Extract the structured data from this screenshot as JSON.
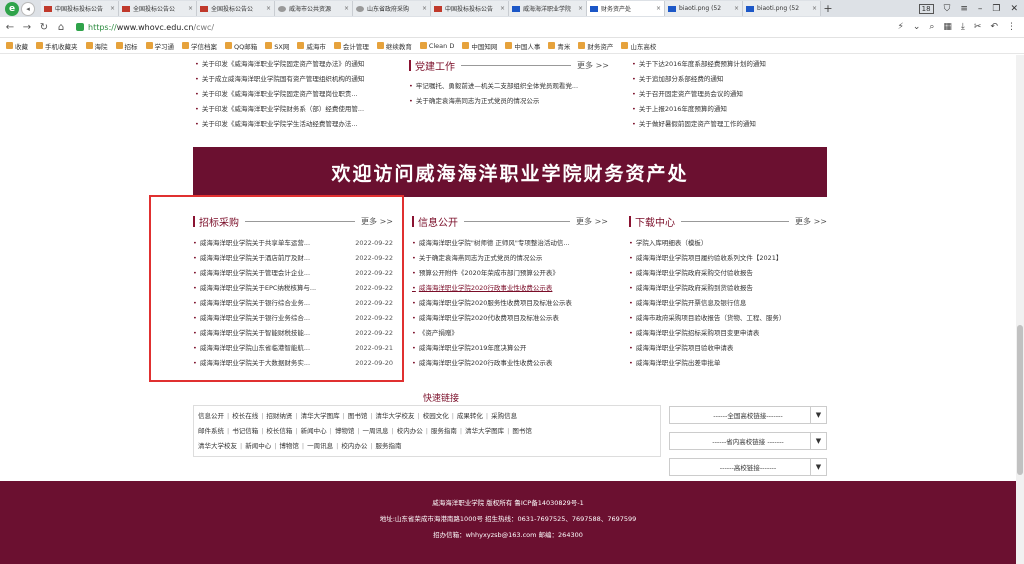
{
  "browser": {
    "tabs": [
      {
        "label": "中国投标投标公告",
        "active": false
      },
      {
        "label": "全国投标公告公",
        "active": false
      },
      {
        "label": "全国投标公告公",
        "active": false
      },
      {
        "label": "威海市公共资源",
        "active": false
      },
      {
        "label": "山东省政府采购",
        "active": false
      },
      {
        "label": "中国投标投标公告",
        "active": false
      },
      {
        "label": "威海海洋职业学院",
        "active": false
      },
      {
        "label": "财务资产处",
        "active": true
      },
      {
        "label": "biaoti.png (52",
        "active": false
      },
      {
        "label": "biaoti.png (52",
        "active": false
      }
    ],
    "window_counter": "18",
    "url_scheme": "https://",
    "url_host": "www.whovc.edu.cn",
    "url_path": "/cwc/",
    "bookmarks": [
      "收藏",
      "手机收藏夹",
      "海院",
      "招标",
      "学习通",
      "学信档案",
      "QQ邮箱",
      "SX网",
      "威海市",
      "会计管理",
      "继续教育",
      "Clean D",
      "中国知网",
      "中国人事",
      "青米",
      "财务资产",
      "山东高校"
    ]
  },
  "top_section": {
    "left_items": [
      "关于印发《威海海洋职业学院固定资产管理办法》的通知",
      "关于成立威海海洋职业学院国有资产管理组织机构的通知",
      "关于印发《威海海洋职业学院固定资产管理岗位职责...",
      "关于印发《威海海洋职业学院财务系（部）经费使用管...",
      "关于印发《威海海洋职业学院学生活动经费管理办法..."
    ],
    "party": {
      "title": "党建工作",
      "more": "更多 >>",
      "items": [
        "牢记嘱托、勇毅前进—机关二支部组织全体党员观看党...",
        "关于确定袁海燕同志为正式党员的情况公示"
      ]
    },
    "right_items": [
      "关于下达2016年度系部经费预算计划的通知",
      "关于追加部分系部经费的通知",
      "关于召开固定资产管理员会议的通知",
      "关于上报2016年度预算的通知",
      "关于做好暑假前固定资产管理工作的通知"
    ]
  },
  "banner": {
    "text": "欢迎访问威海海洋职业学院财务资产处"
  },
  "bidding": {
    "title": "招标采购",
    "more": "更多 >>",
    "items": [
      {
        "title": "威海海洋职业学院关于共享单车运营...",
        "date": "2022-09-22"
      },
      {
        "title": "威海海洋职业学院关于酒店前厅及财...",
        "date": "2022-09-22"
      },
      {
        "title": "威海海洋职业学院关于管理会计企业...",
        "date": "2022-09-22"
      },
      {
        "title": "威海海洋职业学院关于EPC纳税核算与...",
        "date": "2022-09-22"
      },
      {
        "title": "威海海洋职业学院关于银行综合业务...",
        "date": "2022-09-22"
      },
      {
        "title": "威海海洋职业学院关于银行业务综合...",
        "date": "2022-09-22"
      },
      {
        "title": "威海海洋职业学院关于智能财税技能...",
        "date": "2022-09-22"
      },
      {
        "title": "威海海洋职业学院山东省临港智能航...",
        "date": "2022-09-21"
      },
      {
        "title": "威海海洋职业学院关于大数据财务实...",
        "date": "2022-09-20"
      }
    ]
  },
  "info": {
    "title": "信息公开",
    "more": "更多 >>",
    "items": [
      "威海海洋职业学院\"树师德 正师风\"专项整治活动信...",
      "关于确定袁海燕同志为正式党员的情况公示",
      "预算公开附件《2020年荣成市部门预算公开表》",
      "威海海洋职业学院2020行政事业性收费公示表",
      "威海海洋职业学院2020服务性收费项目及标准公示表",
      "威海海洋职业学院2020代收费项目及标准公示表",
      "《资产捐赠》",
      "威海海洋职业学院2019年度决算公开",
      "威海海洋职业学院2020行政事业性收费公示表"
    ]
  },
  "download": {
    "title": "下载中心",
    "more": "更多 >>",
    "items": [
      "学院入库明细表（模板）",
      "威海海洋职业学院项目履约验收系列文件【2021】",
      "威海海洋职业学院政府采购交付验收报告",
      "威海海洋职业学院政府采购到货验收报告",
      "威海海洋职业学院开票信息及银行信息",
      "威海市政府采购项目验收报告（货物、工程、服务）",
      "威海海洋职业学院招标采购项目变更申请表",
      "威海海洋职业学院项目验收申请表",
      "威海海洋职业学院出差审批单"
    ]
  },
  "quick_links": {
    "title": "快速链接",
    "rows": [
      [
        "信息公开",
        "校长在线",
        "招财纳贤",
        "清华大学图库",
        "图书馆",
        "清华大学校友",
        "校园文化",
        "成果转化",
        "采购信息"
      ],
      [
        "邮件系统",
        "书记信箱",
        "校长信箱",
        "新闻中心",
        "博物馆",
        "一周讯息",
        "校内办公",
        "服务指南",
        "清华大学图库",
        "图书馆"
      ],
      [
        "清华大学校友",
        "新闻中心",
        "博物馆",
        "一周讯息",
        "校内办公",
        "服务指南"
      ]
    ],
    "selects": [
      "------全国高校链接-------",
      "------省内高校链接 -------",
      "------高校链接-------"
    ]
  },
  "footer": {
    "line1": "威海海洋职业学院 版权所有  鲁ICP备14030829号-1",
    "line2": "地址:山东省荣成市海港南路1000号  招生热线：0631-7697525、7697588、7697599",
    "line3": "招办信箱：whhyxyzsb@163.com   邮编：264300"
  },
  "colors": {
    "brand": "#6b1030",
    "highlight_box": "#e03030"
  }
}
